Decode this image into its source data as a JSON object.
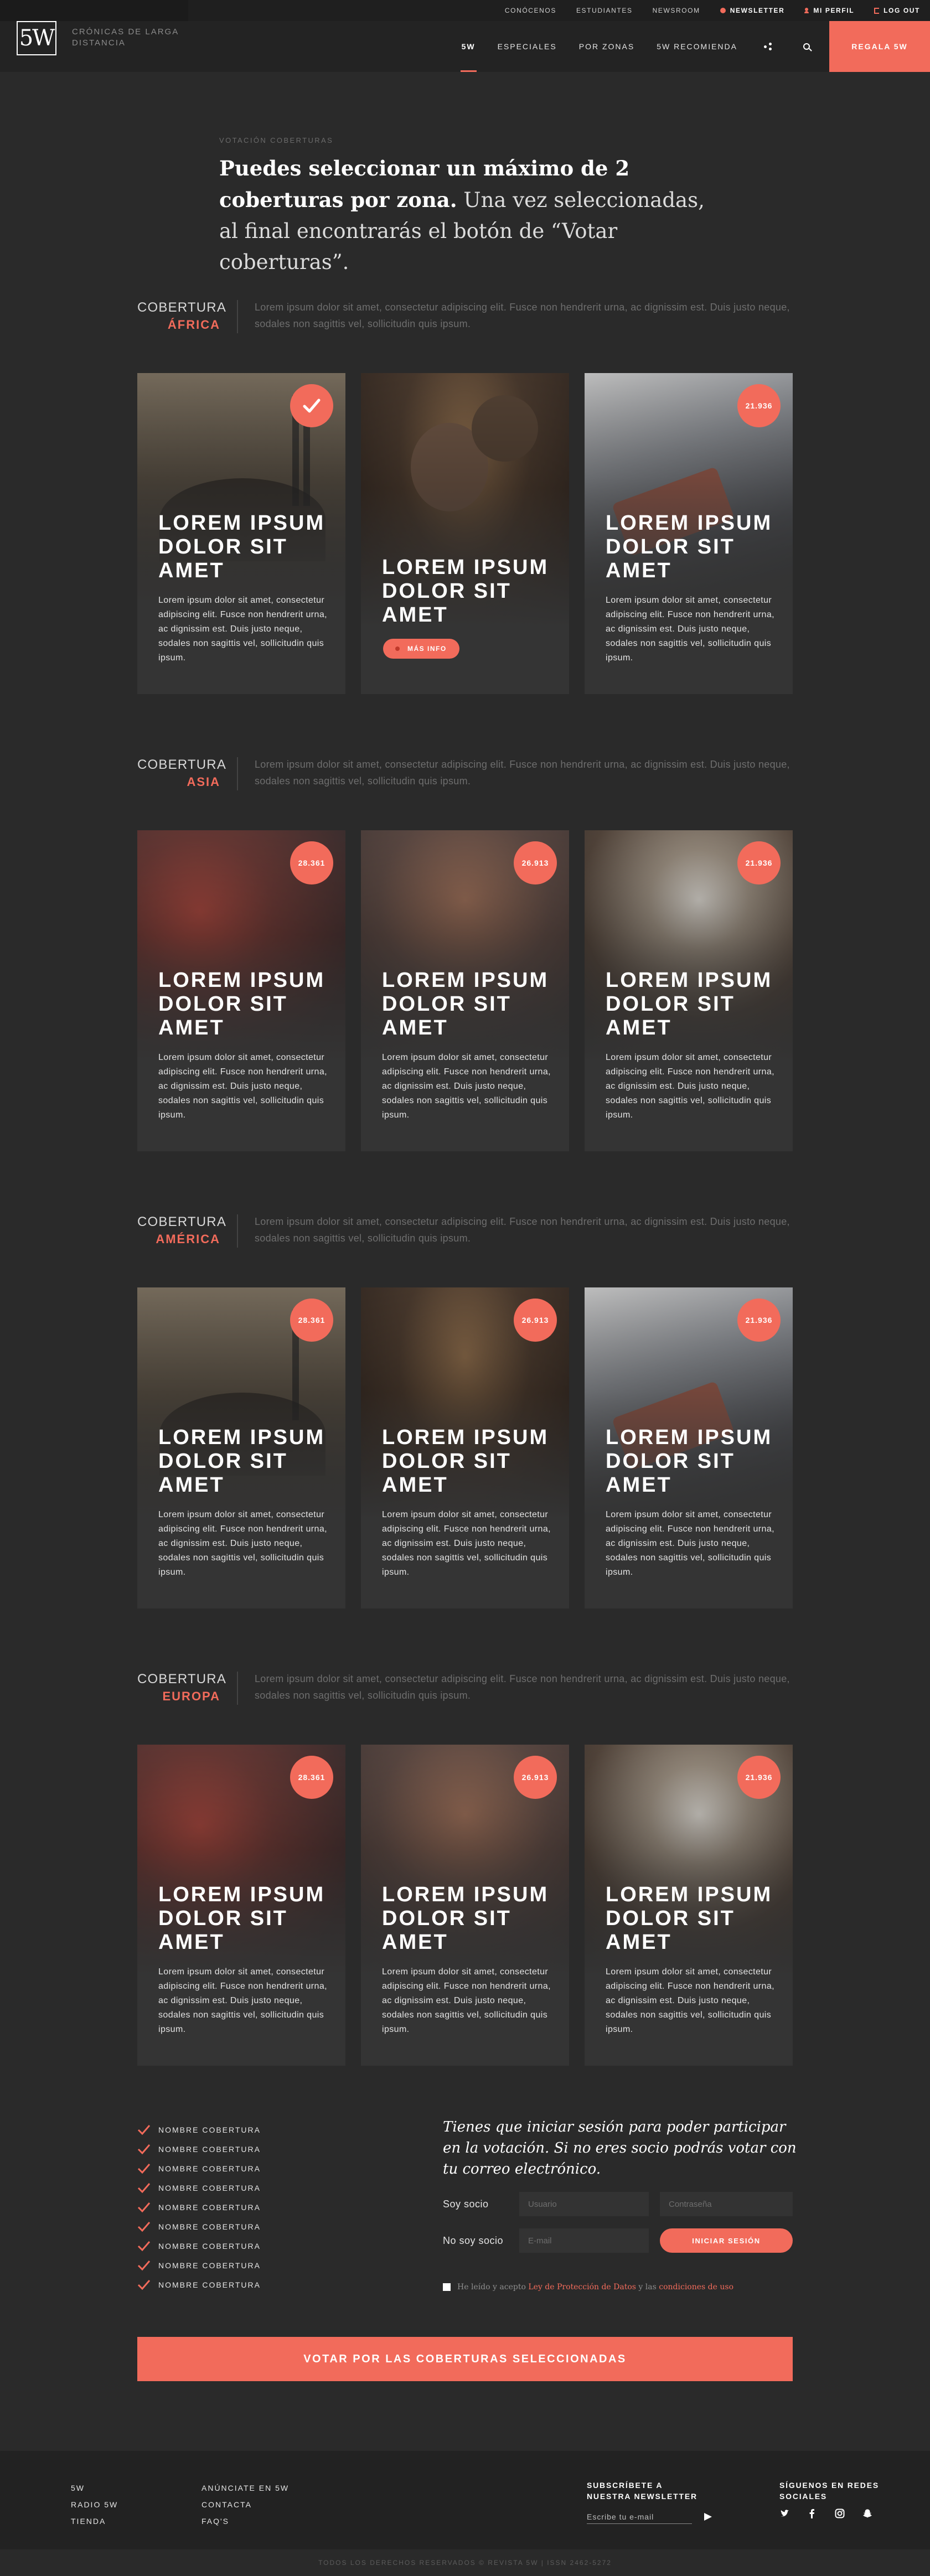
{
  "topbar": {
    "links": [
      "Conócenos",
      "Estudiantes",
      "Newsroom"
    ],
    "newsletter": "Newsletter",
    "profile": "Mi perfil",
    "logout": "Log out"
  },
  "header": {
    "logo": "5W",
    "tagline": "Crónicas de larga distancia",
    "nav": [
      "5W",
      "Especiales",
      "Por zonas",
      "5W Recomienda"
    ],
    "cta": "Regala 5W"
  },
  "intro": {
    "eyebrow": "Votación coberturas",
    "bold": "Puedes seleccionar un máximo de 2 coberturas por zona.",
    "rest": " Una vez seleccionadas, al final encontrarás el botón de “Votar coberturas”."
  },
  "sections": [
    {
      "word1": "Cobertura",
      "word2": "África",
      "desc": "Lorem ipsum dolor sit amet, consectetur adipiscing elit. Fusce non hendrerit urna, ac dignissim est. Duis justo neque, sodales non sagittis vel, sollicitudin quis ipsum.",
      "cards": [
        {
          "title": "Lorem ipsum dolor sit amet",
          "text": "Lorem ipsum dolor sit amet, consectetur adipiscing elit. Fusce non hendrerit urna, ac dignissim est. Duis justo neque, sodales non sagittis vel, sollicitudin quis ipsum.",
          "badge": ""
        },
        {
          "title": "Lorem ipsum dolor sit amet",
          "text": "",
          "button": "Más info"
        },
        {
          "title": "Lorem ipsum dolor sit amet",
          "text": "Lorem ipsum dolor sit amet, consectetur adipiscing elit. Fusce non hendrerit urna, ac dignissim est. Duis justo neque, sodales non sagittis vel, sollicitudin quis ipsum.",
          "badge": "21.936"
        }
      ]
    },
    {
      "word1": "Cobertura",
      "word2": "Asia",
      "desc": "Lorem ipsum dolor sit amet, consectetur adipiscing elit. Fusce non hendrerit urna, ac dignissim est. Duis justo neque, sodales non sagittis vel, sollicitudin quis ipsum.",
      "cards": [
        {
          "title": "Lorem ipsum dolor sit amet",
          "text": "Lorem ipsum dolor sit amet, consectetur adipiscing elit. Fusce non hendrerit urna, ac dignissim est. Duis justo neque, sodales non sagittis vel, sollicitudin quis ipsum.",
          "badge": "28.361"
        },
        {
          "title": "Lorem ipsum dolor sit amet",
          "text": "Lorem ipsum dolor sit amet, consectetur adipiscing elit. Fusce non hendrerit urna, ac dignissim est. Duis justo neque, sodales non sagittis vel, sollicitudin quis ipsum.",
          "badge": "26.913"
        },
        {
          "title": "Lorem ipsum dolor sit amet",
          "text": "Lorem ipsum dolor sit amet, consectetur adipiscing elit. Fusce non hendrerit urna, ac dignissim est. Duis justo neque, sodales non sagittis vel, sollicitudin quis ipsum.",
          "badge": "21.936"
        }
      ]
    },
    {
      "word1": "Cobertura",
      "word2": "América",
      "desc": "Lorem ipsum dolor sit amet, consectetur adipiscing elit. Fusce non hendrerit urna, ac dignissim est. Duis justo neque, sodales non sagittis vel, sollicitudin quis ipsum.",
      "cards": [
        {
          "title": "Lorem ipsum dolor sit amet",
          "text": "Lorem ipsum dolor sit amet, consectetur adipiscing elit. Fusce non hendrerit urna, ac dignissim est. Duis justo neque, sodales non sagittis vel, sollicitudin quis ipsum.",
          "badge": "28.361"
        },
        {
          "title": "Lorem ipsum dolor sit amet",
          "text": "Lorem ipsum dolor sit amet, consectetur adipiscing elit. Fusce non hendrerit urna, ac dignissim est. Duis justo neque, sodales non sagittis vel, sollicitudin quis ipsum.",
          "badge": "26.913"
        },
        {
          "title": "Lorem ipsum dolor sit amet",
          "text": "Lorem ipsum dolor sit amet, consectetur adipiscing elit. Fusce non hendrerit urna, ac dignissim est. Duis justo neque, sodales non sagittis vel, sollicitudin quis ipsum.",
          "badge": "21.936"
        }
      ]
    },
    {
      "word1": "Cobertura",
      "word2": "Europa",
      "desc": "Lorem ipsum dolor sit amet, consectetur adipiscing elit. Fusce non hendrerit urna, ac dignissim est. Duis justo neque, sodales non sagittis vel, sollicitudin quis ipsum.",
      "cards": [
        {
          "title": "Lorem ipsum dolor sit amet",
          "text": "Lorem ipsum dolor sit amet, consectetur adipiscing elit. Fusce non hendrerit urna, ac dignissim est. Duis justo neque, sodales non sagittis vel, sollicitudin quis ipsum.",
          "badge": "28.361"
        },
        {
          "title": "Lorem ipsum dolor sit amet",
          "text": "Lorem ipsum dolor sit amet, consectetur adipiscing elit. Fusce non hendrerit urna, ac dignissim est. Duis justo neque, sodales non sagittis vel, sollicitudin quis ipsum.",
          "badge": "26.913"
        },
        {
          "title": "Lorem ipsum dolor sit amet",
          "text": "Lorem ipsum dolor sit amet, consectetur adipiscing elit. Fusce non hendrerit urna, ac dignissim est. Duis justo neque, sodales non sagittis vel, sollicitudin quis ipsum.",
          "badge": "21.936"
        }
      ]
    }
  ],
  "selection": {
    "items": [
      "Nombre cobertura",
      "Nombre cobertura",
      "Nombre cobertura",
      "Nombre cobertura",
      "Nombre cobertura",
      "Nombre cobertura",
      "Nombre cobertura",
      "Nombre cobertura",
      "Nombre cobertura"
    ]
  },
  "login": {
    "intro": "Tienes que iniciar sesión para poder participar en la votación. Si no eres socio podrás votar con tu correo electrónico.",
    "member_label": "Soy socio",
    "user_placeholder": "Usuario",
    "pass_placeholder": "Contraseña",
    "nonmember_label": "No soy socio",
    "email_placeholder": "E-mail",
    "button": "Iniciar sesión",
    "terms_prefix": "He leído y acepto ",
    "terms_link1": "Ley de Protección de Datos",
    "terms_mid": " y las ",
    "terms_link2": "condiciones de uso"
  },
  "vote_button": "Votar por las coberturas seleccionadas",
  "footer": {
    "col1": [
      "5W",
      "Radio 5W",
      "Tienda"
    ],
    "col2": [
      "Anúnciate en 5W",
      "Contacta",
      "FAQ's"
    ],
    "newsletter_title": "Subscríbete a nuestra newsletter",
    "newsletter_placeholder": "Escribe tu e-mail",
    "social_title": "Síguenos en redes sociales",
    "social_icons": [
      "twitter-icon",
      "facebook-icon",
      "instagram-icon",
      "snapchat-icon"
    ],
    "copyright": "Todos los derechos reservados © revista 5W | ISSN 2462-5272"
  },
  "colors": {
    "accent": "#f26b5b",
    "background": "#2a2a2a",
    "card": "#343434"
  }
}
